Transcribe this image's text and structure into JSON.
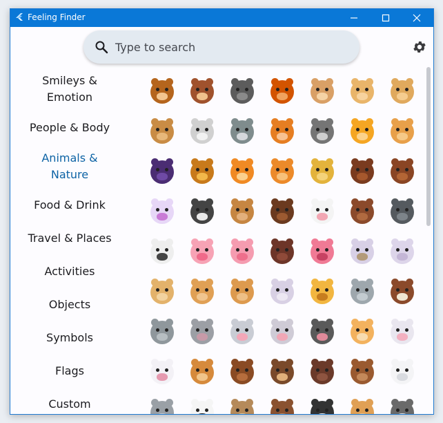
{
  "window": {
    "title": "Feeling Finder"
  },
  "search": {
    "placeholder": "Type to search"
  },
  "sidebar": {
    "items": [
      {
        "label": "Smileys & Emotion",
        "active": false
      },
      {
        "label": "People & Body",
        "active": false
      },
      {
        "label": "Animals & Nature",
        "active": true
      },
      {
        "label": "Food & Drink",
        "active": false
      },
      {
        "label": "Travel & Places",
        "active": false
      },
      {
        "label": "Activities",
        "active": false
      },
      {
        "label": "Objects",
        "active": false
      },
      {
        "label": "Symbols",
        "active": false
      },
      {
        "label": "Flags",
        "active": false
      },
      {
        "label": "Custom",
        "active": false
      }
    ]
  },
  "emoji_grid": {
    "rows": [
      [
        {
          "name": "monkey-face",
          "body": "#b5651d",
          "face": "#f3c58f"
        },
        {
          "name": "monkey",
          "body": "#a0522d",
          "face": "#f0c18c"
        },
        {
          "name": "gorilla",
          "body": "#5c5c5c",
          "face": "#8a8a8a"
        },
        {
          "name": "orangutan",
          "body": "#d35400",
          "face": "#f0a35e"
        },
        {
          "name": "dog-face",
          "body": "#d9a066",
          "face": "#f5d3a5"
        },
        {
          "name": "dog",
          "body": "#e9b56a",
          "face": "#f7d39e"
        },
        {
          "name": "guide-dog",
          "body": "#e0a95d",
          "face": "#f5cc8f"
        }
      ],
      [
        {
          "name": "service-dog",
          "body": "#c98c45",
          "face": "#e8b87a"
        },
        {
          "name": "poodle",
          "body": "#d0d0d0",
          "face": "#f2f2f2"
        },
        {
          "name": "wolf",
          "body": "#7f8c8d",
          "face": "#d5d8dc"
        },
        {
          "name": "fox",
          "body": "#e67e22",
          "face": "#f8c291"
        },
        {
          "name": "raccoon",
          "body": "#757575",
          "face": "#cfcfcf"
        },
        {
          "name": "cat-face",
          "body": "#f5a623",
          "face": "#fcd28b"
        },
        {
          "name": "cat",
          "body": "#e8a04a",
          "face": "#f6c988"
        }
      ],
      [
        {
          "name": "black-cat",
          "body": "#4b2d73",
          "face": "#6f4aa5"
        },
        {
          "name": "lion",
          "body": "#c87a1b",
          "face": "#f2b84a"
        },
        {
          "name": "tiger-face",
          "body": "#f08a24",
          "face": "#fbd08e"
        },
        {
          "name": "tiger",
          "body": "#ec8a2a",
          "face": "#f7c07a"
        },
        {
          "name": "leopard",
          "body": "#e3b33c",
          "face": "#f4d37a"
        },
        {
          "name": "horse-face",
          "body": "#7a3b1f",
          "face": "#a6582d"
        },
        {
          "name": "horse",
          "body": "#8a4524",
          "face": "#b36535"
        }
      ],
      [
        {
          "name": "unicorn",
          "body": "#e7d7f7",
          "face": "#c97bd6"
        },
        {
          "name": "zebra",
          "body": "#444444",
          "face": "#e9e9e9"
        },
        {
          "name": "deer",
          "body": "#c68642",
          "face": "#e3b07c"
        },
        {
          "name": "bison",
          "body": "#6b3a1f",
          "face": "#9c5a31"
        },
        {
          "name": "cow-face",
          "body": "#f4f4f4",
          "face": "#f2a7b3"
        },
        {
          "name": "ox",
          "body": "#8b4a2b",
          "face": "#b06a40"
        },
        {
          "name": "water-buffalo",
          "body": "#555a5f",
          "face": "#7d848a"
        }
      ],
      [
        {
          "name": "cow",
          "body": "#eeeeee",
          "face": "#444444"
        },
        {
          "name": "pig-face",
          "body": "#f7a3b5",
          "face": "#f06a8a"
        },
        {
          "name": "pig",
          "body": "#f59cb0",
          "face": "#ee6f8c"
        },
        {
          "name": "boar",
          "body": "#6d3528",
          "face": "#8f4a39"
        },
        {
          "name": "pig-nose",
          "body": "#f07a95",
          "face": "#c74263"
        },
        {
          "name": "ram",
          "body": "#d8d0e6",
          "face": "#b39a7a"
        },
        {
          "name": "ewe",
          "body": "#ddd5ea",
          "face": "#c4b6d6"
        }
      ],
      [
        {
          "name": "goat",
          "body": "#e3b26b",
          "face": "#f2d3a0"
        },
        {
          "name": "camel",
          "body": "#e0a055",
          "face": "#f0c58f"
        },
        {
          "name": "two-hump-camel",
          "body": "#dd9a4e",
          "face": "#eebf86"
        },
        {
          "name": "llama",
          "body": "#d8d0e4",
          "face": "#ece7f2"
        },
        {
          "name": "giraffe",
          "body": "#f2b640",
          "face": "#c77d1f"
        },
        {
          "name": "elephant",
          "body": "#9ea7ad",
          "face": "#c3cbd0"
        },
        {
          "name": "mammoth",
          "body": "#8b4a2b",
          "face": "#f0e6d2"
        }
      ],
      [
        {
          "name": "rhinoceros",
          "body": "#8f979c",
          "face": "#b7bec2"
        },
        {
          "name": "hippopotamus",
          "body": "#9c9fa5",
          "face": "#c79aa8"
        },
        {
          "name": "mouse-face",
          "body": "#c9ccd4",
          "face": "#f3a7b8"
        },
        {
          "name": "mouse",
          "body": "#cfcbd6",
          "face": "#f0a7b6"
        },
        {
          "name": "rat",
          "body": "#5a5a5a",
          "face": "#e08a9a"
        },
        {
          "name": "hamster",
          "body": "#f3b25e",
          "face": "#f8dcb0"
        },
        {
          "name": "rabbit-face",
          "body": "#e9e6ef",
          "face": "#f2b0c0"
        }
      ],
      [
        {
          "name": "rabbit",
          "body": "#f3f1f6",
          "face": "#e59ab0"
        },
        {
          "name": "chipmunk",
          "body": "#d68a3c",
          "face": "#f1c58a"
        },
        {
          "name": "beaver",
          "body": "#8a4b24",
          "face": "#b66d3d"
        },
        {
          "name": "hedgehog",
          "body": "#7a4a2a",
          "face": "#e0b07a"
        },
        {
          "name": "bat",
          "body": "#6b3a2a",
          "face": "#8e5440"
        },
        {
          "name": "bear",
          "body": "#9a5a30",
          "face": "#c4895a"
        },
        {
          "name": "polar-bear",
          "body": "#f4f4f6",
          "face": "#d9dbe0"
        }
      ],
      [
        {
          "name": "koala",
          "body": "#9aa0a6",
          "face": "#c9ced3"
        },
        {
          "name": "panda",
          "body": "#f5f5f5",
          "face": "#222222"
        },
        {
          "name": "sloth",
          "body": "#b58a5a",
          "face": "#e3c9a0"
        },
        {
          "name": "otter",
          "body": "#8a5230",
          "face": "#c08a60"
        },
        {
          "name": "skunk",
          "body": "#333333",
          "face": "#f0f0f0"
        },
        {
          "name": "kangaroo",
          "body": "#e0a055",
          "face": "#f1c58f"
        },
        {
          "name": "badger",
          "body": "#6a6a6a",
          "face": "#e8e8e8"
        }
      ]
    ]
  }
}
